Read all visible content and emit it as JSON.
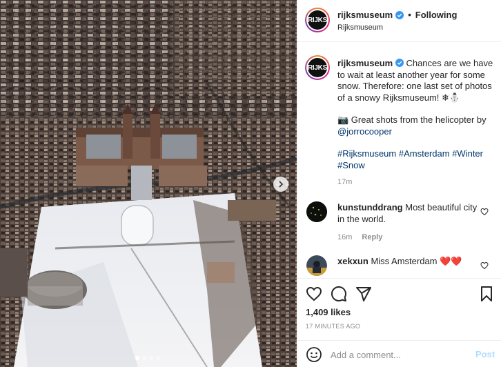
{
  "post": {
    "username": "rijksmuseum",
    "follow_state": "Following",
    "separator": "•",
    "location": "Rijksmuseum",
    "avatar_text": "RIJKS"
  },
  "caption": {
    "username": "rijksmuseum",
    "text1": "Chances are we have to wait at least another year for some snow. Therefore: one last set of photos of a snowy Rijksmuseum! ❄⛄",
    "text2_prefix": "📷 Great shots from the helicopter by",
    "mention": "@jorrocooper",
    "hashtags": [
      "#Rijksmuseum",
      "#Amsterdam",
      "#Winter",
      "#Snow"
    ],
    "time": "17m"
  },
  "comments": [
    {
      "username": "kunstunddrang",
      "text": "Most beautiful city in the world.",
      "time": "16m",
      "reply_label": "Reply"
    },
    {
      "username": "xekxun",
      "text": "Miss Amsterdam",
      "hearts": "❤️❤️"
    }
  ],
  "actions": {
    "likes": "1,409 likes",
    "time_ago": "17 MINUTES AGO"
  },
  "add_comment": {
    "placeholder": "Add a comment...",
    "post_label": "Post"
  },
  "icons": [
    "verified-icon",
    "carousel-next-icon",
    "like-heart-icon",
    "comment-icon",
    "share-icon",
    "save-bookmark-icon",
    "emoji-icon"
  ],
  "colors": {
    "link": "#00376b",
    "muted": "#8e8e8e",
    "verified": "#3897f0",
    "post_disabled": "#b3dbff",
    "heart": "#ed4956"
  },
  "carousel": {
    "total": 4,
    "active": 1
  }
}
